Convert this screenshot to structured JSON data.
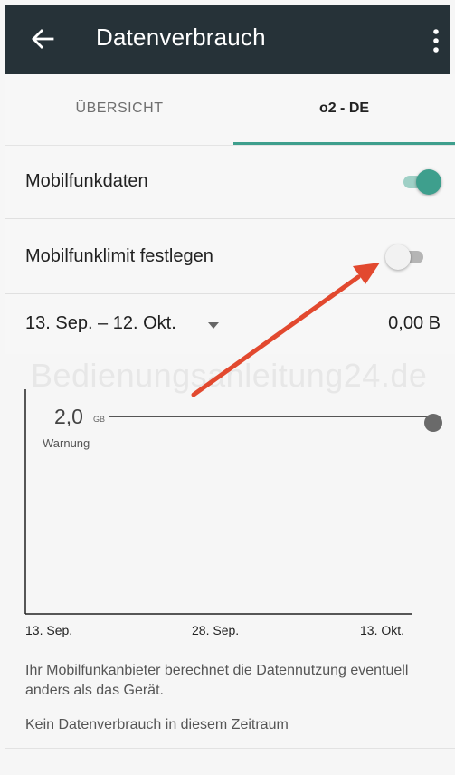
{
  "toolbar": {
    "title": "Datenverbrauch",
    "back_icon": "arrow-left-icon",
    "menu_icon": "more-vertical-icon"
  },
  "tabs": [
    {
      "label": "ÜBERSICHT",
      "selected": false
    },
    {
      "label": "o2 - DE",
      "selected": true
    }
  ],
  "settings": {
    "mobile_data": {
      "label": "Mobilfunkdaten",
      "enabled": true
    },
    "data_limit": {
      "label": "Mobilfunklimit festlegen",
      "enabled": false
    }
  },
  "period": {
    "range": "13. Sep. – 12. Okt.",
    "amount": "0,00 B"
  },
  "chart": {
    "warning_value": "2,0",
    "warning_unit": "GB",
    "warning_label": "Warnung",
    "x_ticks": [
      "13. Sep.",
      "28. Sep.",
      "13. Okt."
    ],
    "watermark": "Bedienungsanleitung24.de"
  },
  "notes": {
    "carrier_note": "Ihr Mobilfunkanbieter berechnet die Datennutzung eventuell anders als das Gerät.",
    "no_usage": "Kein Datenverbrauch in diesem Zeitraum"
  },
  "colors": {
    "toolbar_bg": "#263238",
    "accent": "#3e9f8d",
    "annotation_arrow": "#e2492f"
  }
}
